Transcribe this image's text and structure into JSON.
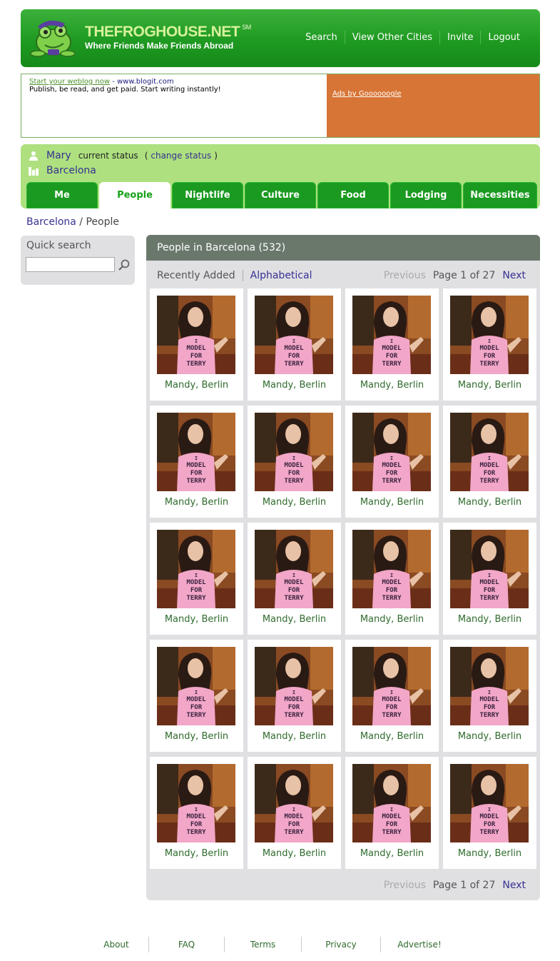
{
  "header": {
    "logo_title": "THEFROGHOUSE.NET",
    "logo_sm": "SM",
    "tagline": "Where Friends Make Friends Abroad",
    "nav": [
      "Search",
      "View Other Cities",
      "Invite",
      "Logout"
    ]
  },
  "ad": {
    "link_text": "Start your weblog now",
    "url_text": " - www.blogit.com",
    "body": "Publish, be read, and get paid. Start writing instantly!",
    "google_link": "Ads by Goooooogle"
  },
  "user": {
    "name": "Mary",
    "status_label": "current status",
    "change_open": "(",
    "change_status": "change status",
    "change_close": ")",
    "city": "Barcelona"
  },
  "tabs": [
    "Me",
    "People",
    "Nightlife",
    "Culture",
    "Food",
    "Lodging",
    "Necessities"
  ],
  "active_tab": "People",
  "breadcrumb": {
    "city": "Barcelona",
    "sep": " / ",
    "current": "People"
  },
  "quick_search": {
    "label": "Quick search",
    "value": ""
  },
  "panel": {
    "title": "People in Barcelona (532)",
    "sort_recent": "Recently Added",
    "sort_alpha": "Alphabetical",
    "pager": {
      "prev": "Previous",
      "info": "Page 1 of 27",
      "next": "Next"
    }
  },
  "people": [
    "Mandy, Berlin",
    "Mandy, Berlin",
    "Mandy, Berlin",
    "Mandy, Berlin",
    "Mandy, Berlin",
    "Mandy, Berlin",
    "Mandy, Berlin",
    "Mandy, Berlin",
    "Mandy, Berlin",
    "Mandy, Berlin",
    "Mandy, Berlin",
    "Mandy, Berlin",
    "Mandy, Berlin",
    "Mandy, Berlin",
    "Mandy, Berlin",
    "Mandy, Berlin",
    "Mandy, Berlin",
    "Mandy, Berlin",
    "Mandy, Berlin",
    "Mandy, Berlin"
  ],
  "shirt_text": [
    "I",
    "MODEL",
    "FOR",
    "TERRY"
  ],
  "footer": [
    "About",
    "FAQ",
    "Terms",
    "Privacy",
    "Advertise!"
  ],
  "colors": {
    "brand_green": "#1f9a21",
    "light_green": "#aee07f",
    "link_blue": "#363191",
    "ad_orange": "#d77536",
    "panel_header": "#6a786c"
  }
}
